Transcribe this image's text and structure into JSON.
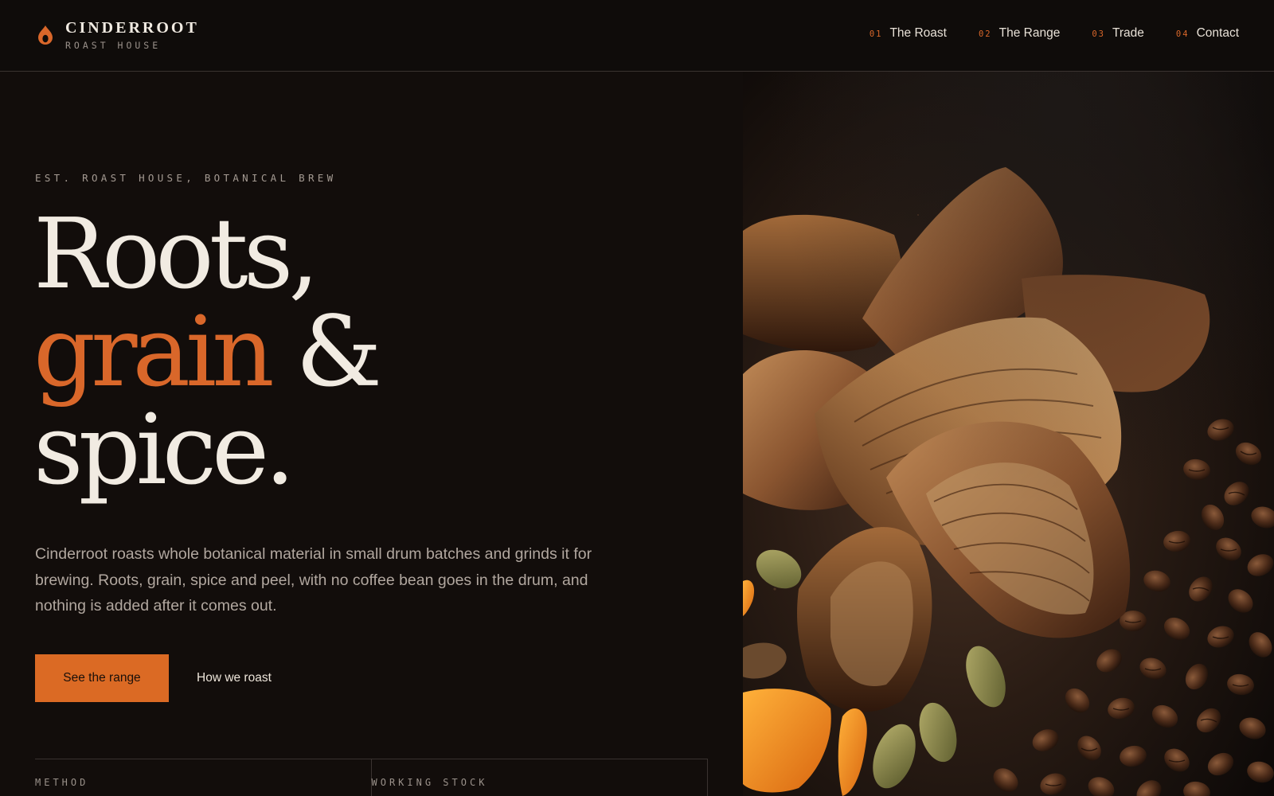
{
  "brand": {
    "name": "CINDERROOT",
    "subtitle": "ROAST HOUSE",
    "icon": "flame-icon",
    "accent": "#d9672a"
  },
  "nav": {
    "items": [
      {
        "num": "01",
        "label": "The Roast"
      },
      {
        "num": "02",
        "label": "The Range"
      },
      {
        "num": "03",
        "label": "Trade"
      },
      {
        "num": "04",
        "label": "Contact"
      }
    ]
  },
  "hero": {
    "eyebrow": "EST. ROAST HOUSE, BOTANICAL BREW",
    "headline": {
      "line1": "Roots,",
      "line2_accent": "grain",
      "line2_rest": "&",
      "line3": "spice."
    },
    "lead": "Cinderroot roasts whole botanical material in small drum batches and grinds it for brewing. Roots, grain, spice and peel, with no coffee bean goes in the drum, and nothing is added after it comes out.",
    "primary_cta": "See the range",
    "secondary_cta": "How we roast",
    "stats": [
      {
        "label": "METHOD"
      },
      {
        "label": "WORKING STOCK"
      }
    ],
    "image_alt": "Roasted chicory root pieces with coffee beans, cardamom pods and orange peel"
  },
  "colors": {
    "background": "#120d0b",
    "header_bg": "#0f0c0a",
    "accent": "#d9672a",
    "text": "#f1ebe2",
    "muted": "#b1a79f"
  }
}
